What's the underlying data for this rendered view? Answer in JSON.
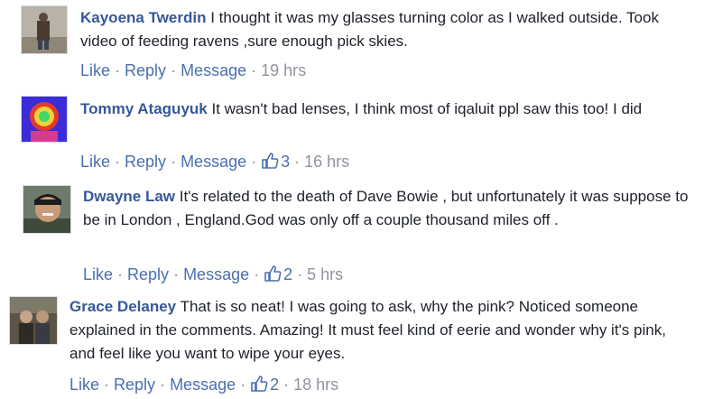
{
  "comments": [
    {
      "author": "Kayoena Twerdin",
      "text": "I thought it was my glasses turning color as I walked outside. Took video of feeding ravens ,sure enough pick skies.",
      "actions": {
        "like": "Like",
        "reply": "Reply",
        "message": "Message"
      },
      "like_count": "",
      "time": "19 hrs"
    },
    {
      "author": "Tommy Ataguyuk",
      "text": "It wasn't bad lenses, I think most of iqaluit ppl saw this too! I did",
      "actions": {
        "like": "Like",
        "reply": "Reply",
        "message": "Message"
      },
      "like_count": "3",
      "time": "16 hrs"
    },
    {
      "author": "Dwayne Law",
      "text": "It's related to the death of Dave Bowie , but unfortunately it was suppose to be in London , England.God was only off a couple thousand miles off .",
      "actions": {
        "like": "Like",
        "reply": "Reply",
        "message": "Message"
      },
      "like_count": "2",
      "time": "5 hrs"
    },
    {
      "author": "Grace Delaney",
      "text": "That is so neat! I was going to ask, why the pink? Noticed someone explained in the comments. Amazing! It must feel kind of eerie and wonder why it's pink, and feel like you want to wipe your eyes.",
      "actions": {
        "like": "Like",
        "reply": "Reply",
        "message": "Message"
      },
      "like_count": "2",
      "time": "18 hrs"
    }
  ],
  "colors": {
    "author": "#365899",
    "action_link": "#4b6fb0",
    "muted": "#90949c",
    "text": "#1d2129"
  },
  "icons": {
    "like_count": "thumbs-up-icon"
  }
}
